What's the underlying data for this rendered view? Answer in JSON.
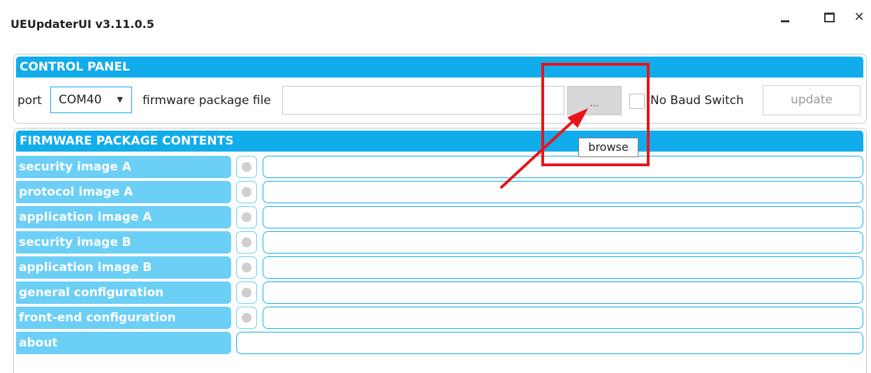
{
  "window": {
    "title": "UEUpdaterUI v3.11.0.5"
  },
  "control_panel": {
    "header": "CONTROL PANEL",
    "port_label": "port",
    "port_value": "COM40",
    "firmware_label": "firmware package file",
    "firmware_value": "",
    "browse_label": "...",
    "no_baud_switch_label": "No Baud Switch",
    "update_label": "update"
  },
  "tooltip": {
    "text": "browse"
  },
  "contents": {
    "header": "FIRMWARE PACKAGE CONTENTS",
    "rows": [
      {
        "label": "security image A",
        "value": ""
      },
      {
        "label": "protocol image A",
        "value": ""
      },
      {
        "label": "application image A",
        "value": ""
      },
      {
        "label": "security image B",
        "value": ""
      },
      {
        "label": "application image B",
        "value": ""
      },
      {
        "label": "general configuration",
        "value": ""
      },
      {
        "label": "front-end configuration",
        "value": ""
      }
    ],
    "about_label": "about",
    "about_value": ""
  },
  "colors": {
    "header": "#11aceb",
    "row_label": "#6ccff5",
    "annotation": "#e8141b"
  }
}
